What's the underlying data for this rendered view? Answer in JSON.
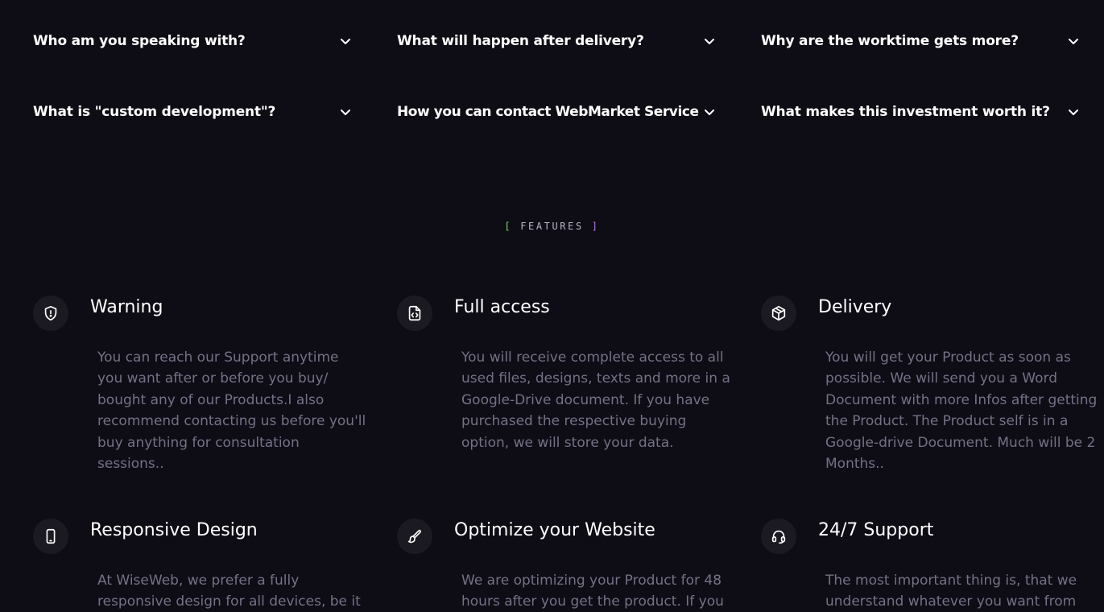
{
  "faq": {
    "items": [
      {
        "question": "Who am you speaking with?"
      },
      {
        "question": "What will happen after delivery?"
      },
      {
        "question": "Why are the worktime gets more?"
      },
      {
        "question": "What is \"custom development\"?"
      },
      {
        "question": "How you can contact WebMarket Service"
      },
      {
        "question": "What makes this investment worth it?"
      }
    ]
  },
  "features_section": {
    "tag": "FEATURES",
    "bracket_left": "[",
    "bracket_right": "]",
    "items": [
      {
        "icon": "shield-icon",
        "title": "Warning",
        "description": "You can reach our Support anytime you want after or before you buy/ bought any of our Products.I also recommend contacting us before you'll buy anything for consultation sessions.."
      },
      {
        "icon": "code-file-icon",
        "title": "Full access",
        "description": "You will receive complete access to all used files, designs, texts and more in a Google-Drive document. If you have purchased the respective buying option, we will store your data."
      },
      {
        "icon": "package-icon",
        "title": "Delivery",
        "description": "You will get your Product as soon as possible. We will send you a Word Document with more Infos after getting the Product. The Product self is in a Google-drive Document. Much will be 2 Months.."
      },
      {
        "icon": "smartphone-icon",
        "title": "Responsive Design",
        "description": "At WiseWeb, we prefer a fully responsive design for all devices, be it"
      },
      {
        "icon": "brush-icon",
        "title": "Optimize your Website",
        "description": "We are optimizing your Product for 48 hours after you get the product. If you"
      },
      {
        "icon": "headset-icon",
        "title": "24/7 Support",
        "description": "The most important thing is, that we understand whatever you want from"
      }
    ]
  },
  "colors": {
    "background": "#0e0c15",
    "icon_background": "#1b1a23",
    "text_primary": "#ffffff",
    "text_muted": "#757185",
    "bracket_green": "#8bd36b",
    "bracket_purple": "#b07de8"
  }
}
